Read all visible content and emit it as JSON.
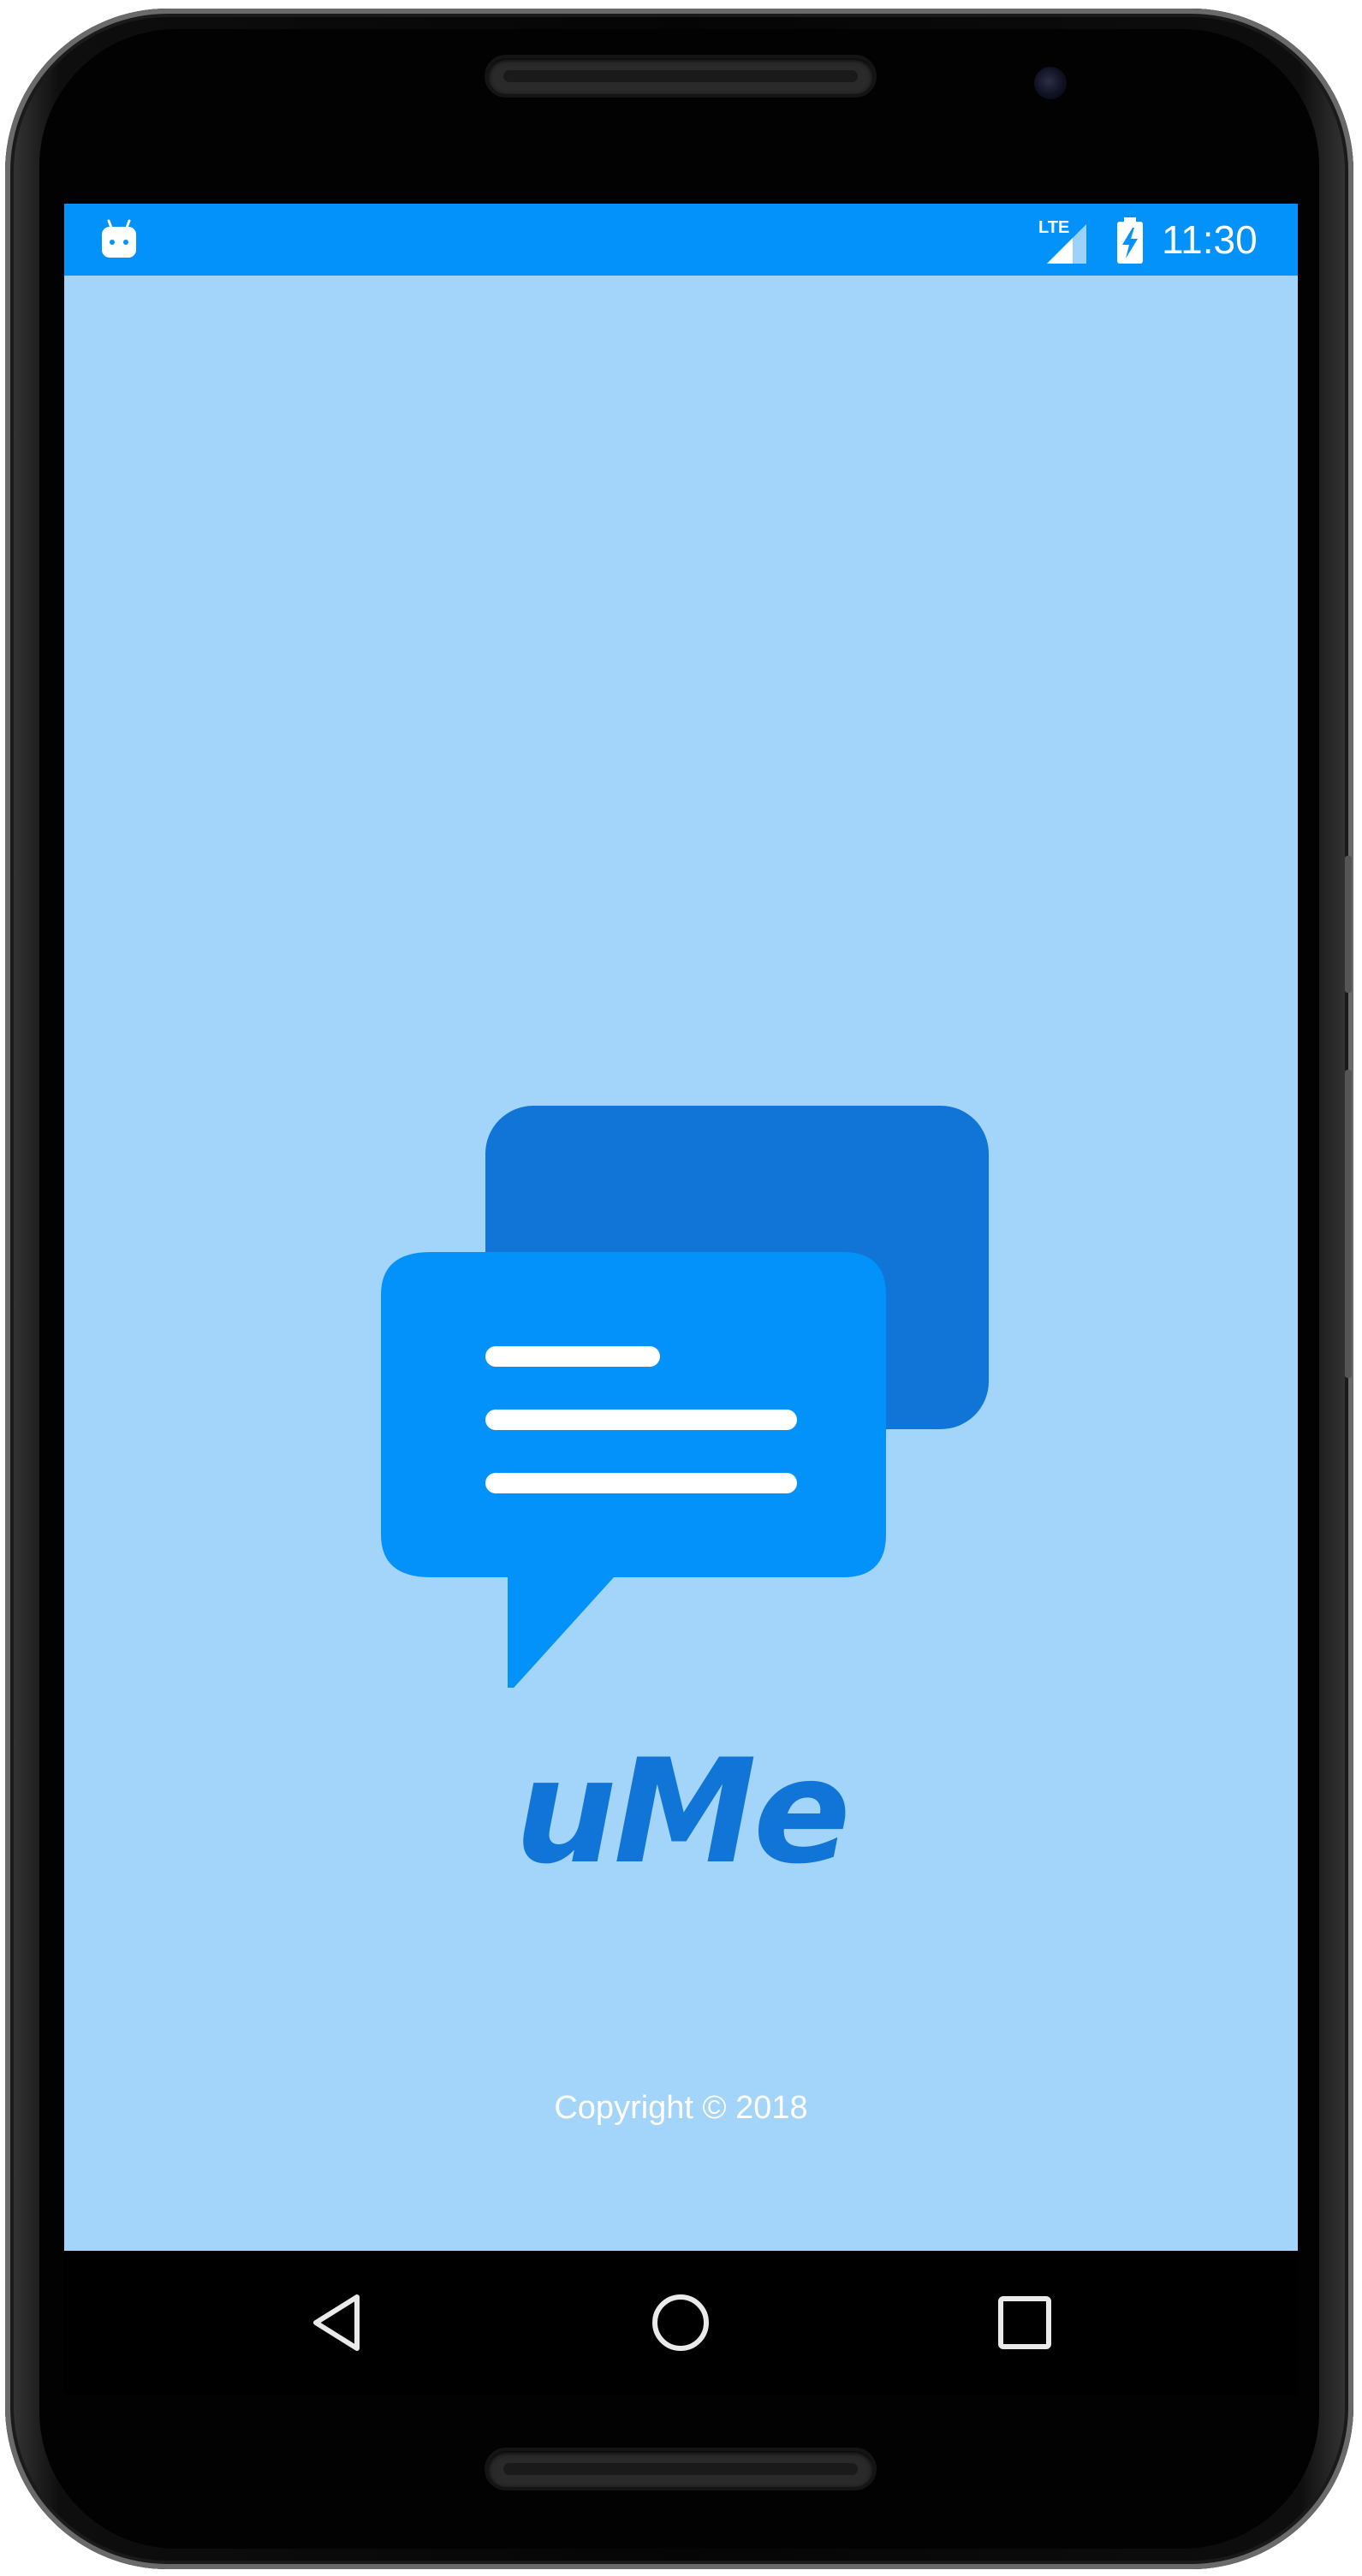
{
  "status_bar": {
    "time": "11:30",
    "network": "LTE",
    "background_color": "#0391fa",
    "left_icon": "android-debug-icon",
    "right_icons": [
      "lte-signal-icon",
      "battery-charging-icon"
    ]
  },
  "splash": {
    "app_name": "uMe",
    "copyright": "Copyright © 2018",
    "background_color": "#a3d4f9",
    "brand_color": "#1175d8",
    "accent_color": "#0391fa",
    "logo_icon": "chat-bubbles-icon"
  },
  "nav_bar": {
    "buttons": [
      "back-icon",
      "home-icon",
      "recents-icon"
    ]
  }
}
